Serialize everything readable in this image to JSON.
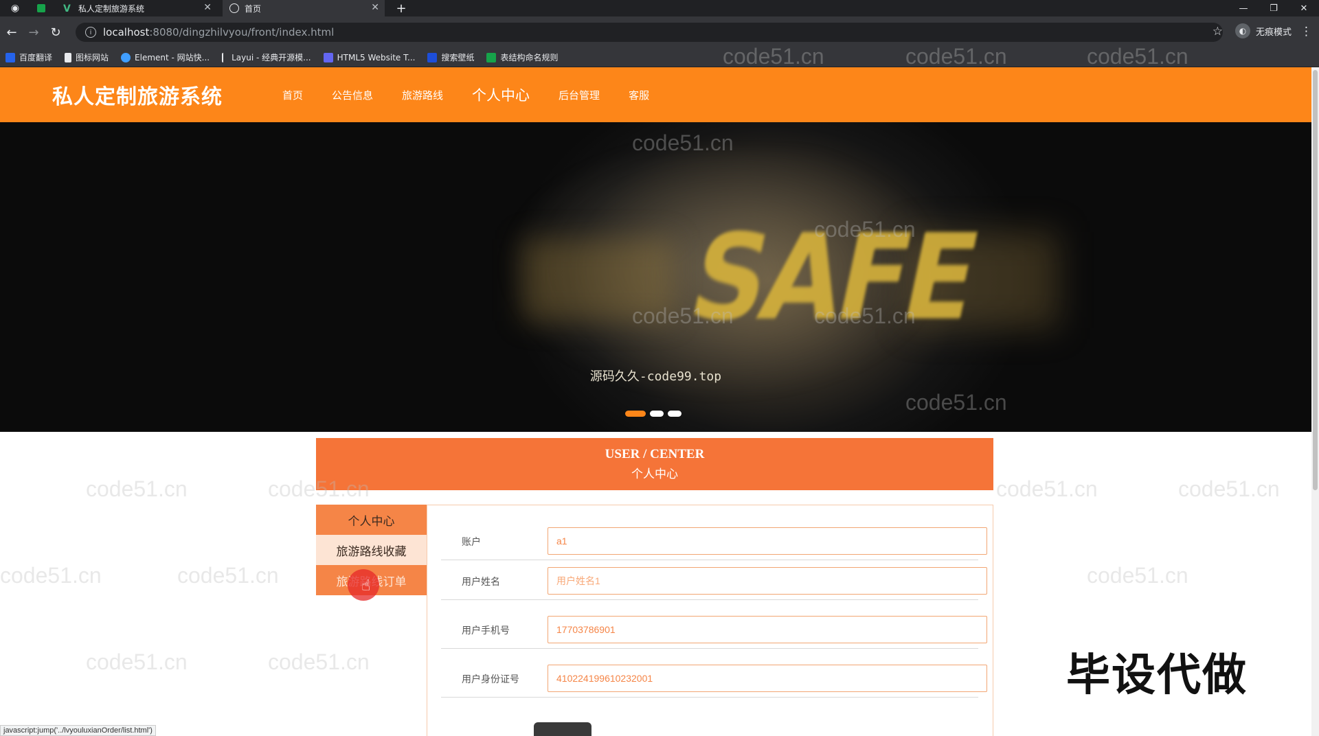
{
  "browser": {
    "tabs": [
      {
        "title": "私人定制旅游系统"
      },
      {
        "title": "首页"
      }
    ],
    "new_tab": "+",
    "url_host": "localhost",
    "url_path": ":8080/dingzhilvyou/front/index.html",
    "profile_label": "无痕模式",
    "bookmarks": [
      "百度翻译",
      "图标网站",
      "Element - 网站快...",
      "Layui - 经典开源模...",
      "HTML5 Website T...",
      "搜索壁纸",
      "表结构命名规则"
    ],
    "status_url": "javascript:jump('../lvyouluxianOrder/list.html')"
  },
  "site": {
    "title": "私人定制旅游系统",
    "nav": [
      "首页",
      "公告信息",
      "旅游路线",
      "个人中心",
      "后台管理",
      "客服"
    ],
    "active_nav": "个人中心"
  },
  "banner": {
    "word": "SAFE",
    "caption": "源码久久-code99.top",
    "slides": 3,
    "active_slide": 1
  },
  "user_center": {
    "title_en": "USER / CENTER",
    "title_zh": "个人中心",
    "side_menu": [
      "个人中心",
      "旅游路线收藏",
      "旅游路线订单"
    ],
    "fields": [
      {
        "label": "账户",
        "value": "a1",
        "placeholder": false
      },
      {
        "label": "用户姓名",
        "value": "用户姓名1",
        "placeholder": true
      },
      {
        "label": "用户手机号",
        "value": "17703786901",
        "placeholder": false
      },
      {
        "label": "用户身份证号",
        "value": "410224199610232001",
        "placeholder": false
      }
    ]
  },
  "watermark_text": "code51.cn",
  "overlay_text": "毕设代做",
  "colors": {
    "brand_orange": "#fd8619",
    "panel_orange": "#f57438",
    "menu_light": "#fde4d4"
  }
}
